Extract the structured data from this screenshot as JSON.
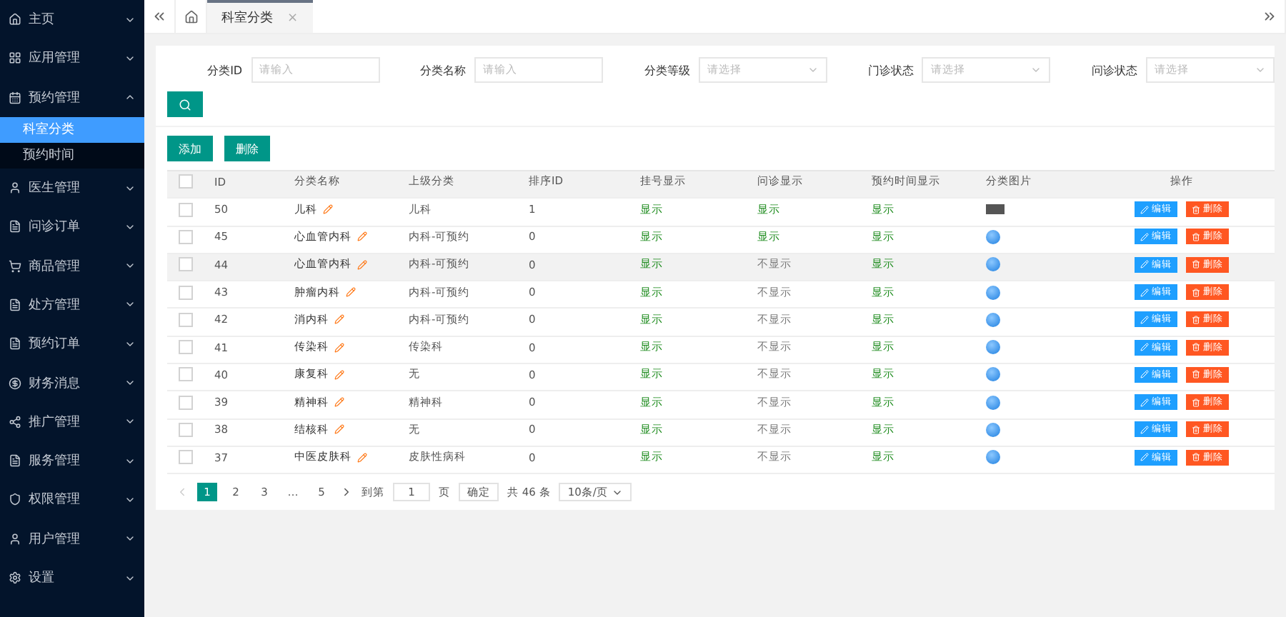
{
  "sidebar": {
    "items": [
      {
        "label": "主页",
        "expanded": false
      },
      {
        "label": "应用管理",
        "expanded": false
      },
      {
        "label": "预约管理",
        "expanded": true,
        "children": [
          {
            "label": "科室分类",
            "selected": true
          },
          {
            "label": "预约时间",
            "selected": false
          }
        ]
      },
      {
        "label": "医生管理",
        "expanded": false
      },
      {
        "label": "问诊订单",
        "expanded": false
      },
      {
        "label": "商品管理",
        "expanded": false
      },
      {
        "label": "处方管理",
        "expanded": false
      },
      {
        "label": "预约订单",
        "expanded": false
      },
      {
        "label": "财务消息",
        "expanded": false
      },
      {
        "label": "推广管理",
        "expanded": false
      },
      {
        "label": "服务管理",
        "expanded": false
      },
      {
        "label": "权限管理",
        "expanded": false
      },
      {
        "label": "用户管理",
        "expanded": false
      },
      {
        "label": "设置",
        "expanded": false
      }
    ]
  },
  "tabs": [
    {
      "label": "科室分类",
      "selected": true,
      "close": "×"
    }
  ],
  "filters": [
    {
      "label": "分类ID",
      "kind": "input",
      "placeholder": "请输入"
    },
    {
      "label": "分类名称",
      "kind": "input",
      "placeholder": "请输入"
    },
    {
      "label": "分类等级",
      "kind": "select",
      "placeholder": "请选择"
    },
    {
      "label": "门诊状态",
      "kind": "select",
      "placeholder": "请选择"
    },
    {
      "label": "问诊状态",
      "kind": "select",
      "placeholder": "请选择"
    }
  ],
  "actions": [
    "添加",
    "删除"
  ],
  "table": {
    "all_checked": false,
    "columns": [
      "ID",
      "分类名称",
      "上级分类",
      "排序ID",
      "挂号显示",
      "问诊显示",
      "预约时间显示",
      "分类图片",
      "操作"
    ],
    "rows": [
      {
        "checked": false,
        "id": "50",
        "name": "儿科",
        "parent": "儿科",
        "sort": "1",
        "reg": {
          "text": "显示",
          "on": true
        },
        "consult": {
          "text": "显示",
          "on": true
        },
        "time": {
          "text": "显示",
          "on": true
        },
        "kind": "photo",
        "highlighted": false,
        "edit": "编辑",
        "delete": "删除"
      },
      {
        "checked": false,
        "id": "45",
        "name": "心血管内科",
        "parent": "内科-可预约",
        "sort": "0",
        "reg": {
          "text": "显示",
          "on": true
        },
        "consult": {
          "text": "显示",
          "on": true
        },
        "time": {
          "text": "显示",
          "on": true
        },
        "kind": "icon",
        "highlighted": false,
        "edit": "编辑",
        "delete": "删除"
      },
      {
        "checked": false,
        "id": "44",
        "name": "心血管内科",
        "parent": "内科-可预约",
        "sort": "0",
        "reg": {
          "text": "显示",
          "on": true
        },
        "consult": {
          "text": "不显示",
          "on": false
        },
        "time": {
          "text": "显示",
          "on": true
        },
        "kind": "icon",
        "highlighted": true,
        "edit": "编辑",
        "delete": "删除"
      },
      {
        "checked": false,
        "id": "43",
        "name": "肿瘤内科",
        "parent": "内科-可预约",
        "sort": "0",
        "reg": {
          "text": "显示",
          "on": true
        },
        "consult": {
          "text": "不显示",
          "on": false
        },
        "time": {
          "text": "显示",
          "on": true
        },
        "kind": "icon",
        "highlighted": false,
        "edit": "编辑",
        "delete": "删除"
      },
      {
        "checked": false,
        "id": "42",
        "name": "消内科",
        "parent": "内科-可预约",
        "sort": "0",
        "reg": {
          "text": "显示",
          "on": true
        },
        "consult": {
          "text": "不显示",
          "on": false
        },
        "time": {
          "text": "显示",
          "on": true
        },
        "kind": "icon",
        "highlighted": false,
        "edit": "编辑",
        "delete": "删除"
      },
      {
        "checked": false,
        "id": "41",
        "name": "传染科",
        "parent": "传染科",
        "sort": "0",
        "reg": {
          "text": "显示",
          "on": true
        },
        "consult": {
          "text": "不显示",
          "on": false
        },
        "time": {
          "text": "显示",
          "on": true
        },
        "kind": "icon",
        "highlighted": false,
        "edit": "编辑",
        "delete": "删除"
      },
      {
        "checked": false,
        "id": "40",
        "name": "康复科",
        "parent": "无",
        "sort": "0",
        "reg": {
          "text": "显示",
          "on": true
        },
        "consult": {
          "text": "不显示",
          "on": false
        },
        "time": {
          "text": "显示",
          "on": true
        },
        "kind": "icon",
        "highlighted": false,
        "edit": "编辑",
        "delete": "删除"
      },
      {
        "checked": false,
        "id": "39",
        "name": "精神科",
        "parent": "精神科",
        "sort": "0",
        "reg": {
          "text": "显示",
          "on": true
        },
        "consult": {
          "text": "不显示",
          "on": false
        },
        "time": {
          "text": "显示",
          "on": true
        },
        "kind": "icon",
        "highlighted": false,
        "edit": "编辑",
        "delete": "删除"
      },
      {
        "checked": false,
        "id": "38",
        "name": "结核科",
        "parent": "无",
        "sort": "0",
        "reg": {
          "text": "显示",
          "on": true
        },
        "consult": {
          "text": "不显示",
          "on": false
        },
        "time": {
          "text": "显示",
          "on": true
        },
        "kind": "icon",
        "highlighted": false,
        "edit": "编辑",
        "delete": "删除"
      },
      {
        "checked": false,
        "id": "37",
        "name": "中医皮肤科",
        "parent": "皮肤性病科",
        "sort": "0",
        "reg": {
          "text": "显示",
          "on": true
        },
        "consult": {
          "text": "不显示",
          "on": false
        },
        "time": {
          "text": "显示",
          "on": true
        },
        "kind": "icon",
        "highlighted": false,
        "edit": "编辑",
        "delete": "删除"
      }
    ]
  },
  "pagination": {
    "pages": [
      {
        "label": "1",
        "selected": true
      },
      {
        "label": "2",
        "selected": false
      },
      {
        "label": "3",
        "selected": false
      },
      {
        "label": "…",
        "selected": false
      },
      {
        "label": "5",
        "selected": false
      }
    ],
    "goto_label": "到第",
    "goto_value": "1",
    "page_unit": "页",
    "confirm": "确定",
    "total": "共 46 条",
    "page_size": "10条/页"
  }
}
